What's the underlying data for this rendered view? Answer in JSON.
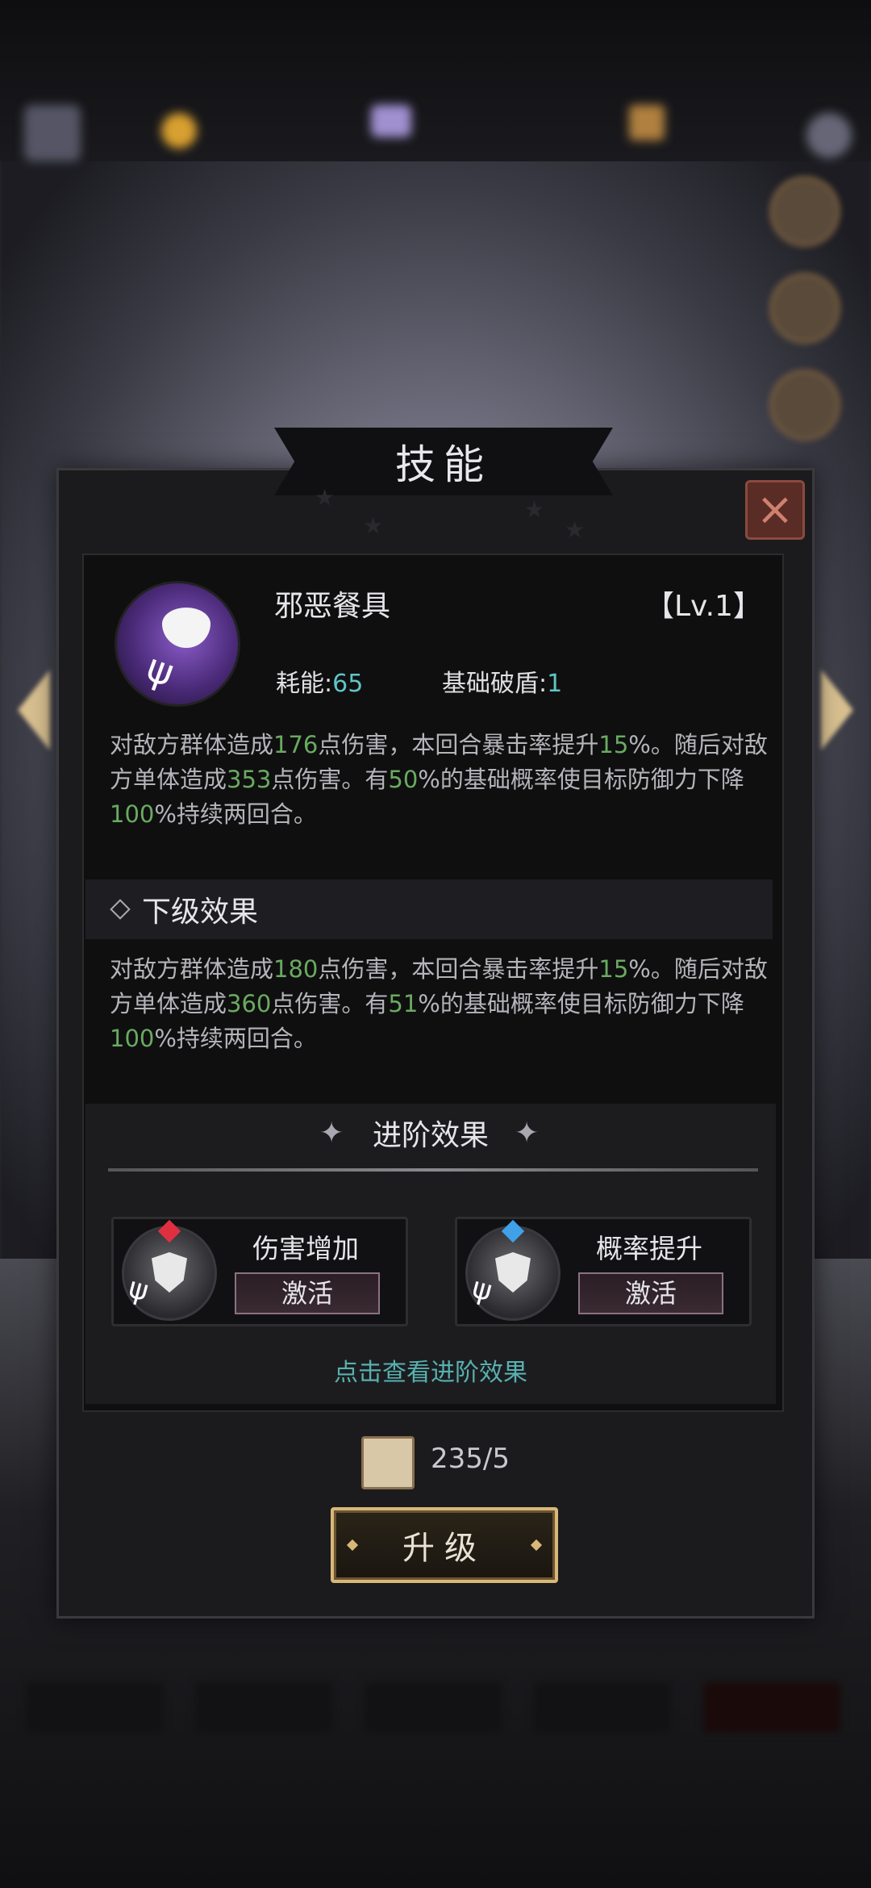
{
  "dialog": {
    "title": "技能",
    "close_icon": "close-icon"
  },
  "skill": {
    "name": "邪恶餐具",
    "level": "【Lv.1】",
    "cost_label": "耗能:",
    "cost_value": "65",
    "shield_label": "基础破盾:",
    "shield_value": "1",
    "desc_segments": [
      {
        "t": "对敌方群体造成"
      },
      {
        "t": "176",
        "g": true
      },
      {
        "t": "点伤害，本回合暴击率提升"
      },
      {
        "t": "15",
        "g": true
      },
      {
        "t": "%。随后对敌方单体造成"
      },
      {
        "t": "353",
        "g": true
      },
      {
        "t": "点伤害。有"
      },
      {
        "t": "50",
        "g": true
      },
      {
        "t": "%的基础概率使目标防御力下降"
      },
      {
        "t": "100",
        "g": true
      },
      {
        "t": "%持续两回合。"
      }
    ]
  },
  "next_level": {
    "title": "下级效果",
    "desc_segments": [
      {
        "t": "对敌方群体造成"
      },
      {
        "t": "180",
        "g": true
      },
      {
        "t": "点伤害，本回合暴击率提升"
      },
      {
        "t": "15",
        "g": true
      },
      {
        "t": "%。随后对敌方单体造成"
      },
      {
        "t": "360",
        "g": true
      },
      {
        "t": "点伤害。有"
      },
      {
        "t": "51",
        "g": true
      },
      {
        "t": "%的基础概率使目标防御力下降"
      },
      {
        "t": "100",
        "g": true
      },
      {
        "t": "%持续两回合。"
      }
    ]
  },
  "advanced": {
    "title": "进阶效果",
    "cards": [
      {
        "name": "伤害增加",
        "button": "激活",
        "gem_color": "#e03040"
      },
      {
        "name": "概率提升",
        "button": "激活",
        "gem_color": "#40a0e8"
      }
    ],
    "view_link": "点击查看进阶效果"
  },
  "upgrade": {
    "cost": "235/5",
    "button": "升级"
  },
  "colors": {
    "highlight_green": "#6aaa60",
    "teal": "#5fc6c6",
    "gold_border": "#d8b878"
  }
}
